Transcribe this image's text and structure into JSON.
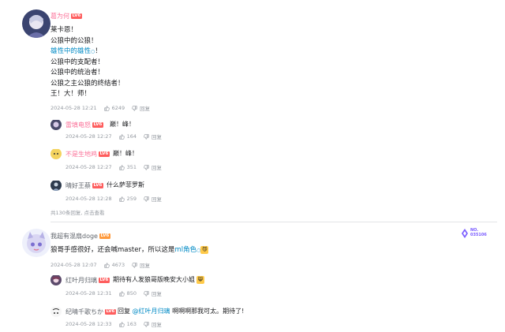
{
  "comments": [
    {
      "user": "葛为何",
      "level": "LV6",
      "lines": [
        "莱卡恩！",
        "公狼中的公狼！",
        "雄性中的雄性",
        "公狼中的支配者！",
        "公狼中的统治者！",
        "公狼之主公狼的终结者！",
        "王！大！师！"
      ],
      "link_suffix": "！",
      "time": "2024-05-28 12:21",
      "likes": "6249",
      "reply_label": "回复",
      "replies": [
        {
          "user": "雷填电怒",
          "level": "LV6",
          "text": "巅！峰！",
          "time": "2024-05-28 12:27",
          "likes": "164",
          "reply_label": "回复"
        },
        {
          "user": "不是生地鸡",
          "level": "LV6",
          "text": "巅！峰！",
          "time": "2024-05-28 12:27",
          "likes": "351",
          "reply_label": "回复"
        },
        {
          "user": "晴好王蔡",
          "level": "LV6",
          "text": "什么萨菲罗斯",
          "time": "2024-05-28 12:28",
          "likes": "259",
          "reply_label": "回复"
        }
      ],
      "more_replies": "共130条回复, 点击查看"
    },
    {
      "user": "我超有混扇doge",
      "level": "LV6",
      "text_prefix": "狼哥手感很好，还会喊master，所以这是",
      "link_text": "ml角色",
      "time": "2024-05-28 12:07",
      "likes": "4673",
      "reply_label": "回复",
      "badge": "NO.\n035106",
      "replies": [
        {
          "user": "红叶月归璃",
          "level": "LV6",
          "text": "期待有人发狼哥版晚安大小姐",
          "time": "2024-05-28 12:31",
          "likes": "850",
          "reply_label": "回复"
        },
        {
          "user": "纪晴千歌ちか",
          "level": "LV6",
          "text_prefix": "回复 ",
          "mention": "@红叶月归璃",
          "text_suffix": " 啊啊啊那我可太。期待了!",
          "time": "2024-05-28 12:33",
          "likes": "163",
          "reply_label": "回复"
        }
      ]
    }
  ],
  "colors": {
    "accent_pink": "#fb7299",
    "link_blue": "#008ac5",
    "meta_grey": "#9499a0"
  }
}
